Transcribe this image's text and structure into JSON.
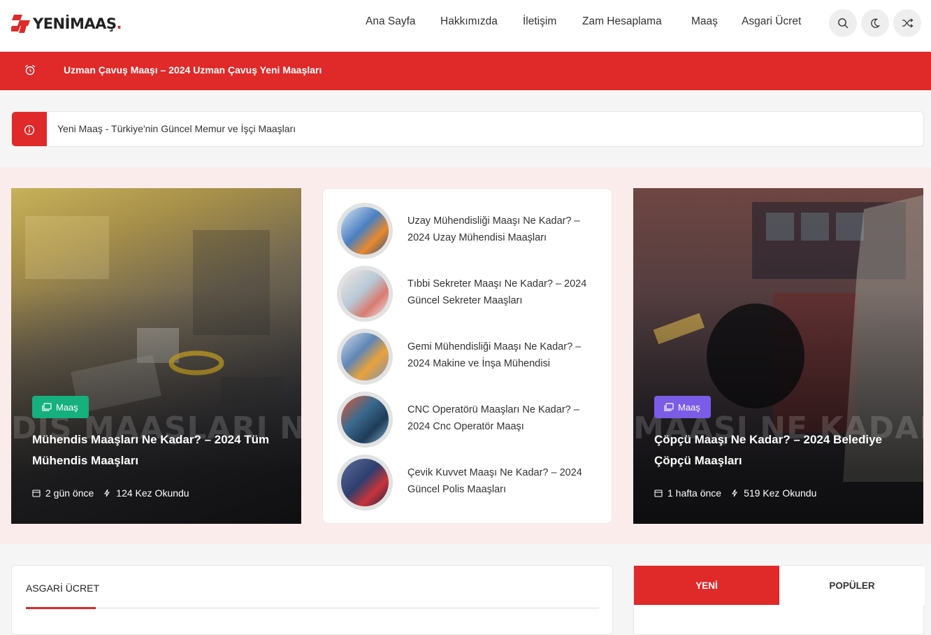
{
  "colors": {
    "accent": "#e02929",
    "badge_green": "#15b07d",
    "badge_purple": "#7b5ce6"
  },
  "logo": {
    "text": "YENİMAAŞ",
    "dot": "."
  },
  "nav": [
    {
      "label": "Ana Sayfa"
    },
    {
      "label": "Hakkımızda"
    },
    {
      "label": "İletişim"
    },
    {
      "label": "Zam Hesaplama"
    },
    {
      "label": "Maaş"
    },
    {
      "label": "Asgari Ücret"
    }
  ],
  "header_icons": [
    "search-icon",
    "moon-icon",
    "shuffle-icon"
  ],
  "breaking": {
    "icon": "alarm-icon",
    "text": "Uzman Çavuş Maaşı – 2024 Uzman Çavuş Yeni Maaşları"
  },
  "ticker": {
    "icon": "info-icon",
    "text": "Yeni Maaş - Türkiye'nin Güncel Memur ve İşçi Maaşları"
  },
  "featured_left": {
    "badge": "Maaş",
    "title": "Mühendis Maaşları Ne Kadar? – 2024 Tüm Mühendis Maaşları",
    "watermark": "DIS MAAŞLARI NE",
    "date": "2 gün önce",
    "views": "124 Kez Okundu"
  },
  "featured_right": {
    "badge": "Maaş",
    "title": "Çöpçü Maaşı Ne Kadar? – 2024 Belediye Çöpçü Maaşları",
    "watermark": "MAAŞI NE KADAR",
    "date": "1 hafta önce",
    "views": "519 Kez Okundu"
  },
  "list_items": [
    {
      "title": "Uzay Mühendisliği Maaşı Ne Kadar? – 2024 Uzay Mühendisi Maaşları",
      "thumb_color": "#4a7fc1"
    },
    {
      "title": "Tıbbi Sekreter Maaşı Ne Kadar? – 2024 Güncel Sekreter Maaşları",
      "thumb_color": "#b7c9d6"
    },
    {
      "title": "Gemi Mühendisliği Maaşı Ne Kadar? – 2024 Makine ve İnşa Mühendisi",
      "thumb_color": "#5f86b5"
    },
    {
      "title": "CNC Operatörü Maaşları Ne Kadar? – 2024 Cnc Operatör Maaşı",
      "thumb_color": "#3b6a8f"
    },
    {
      "title": "Çevik Kuvvet Maaşı Ne Kadar? – 2024 Güncel Polis Maaşları",
      "thumb_color": "#2e3e6e"
    }
  ],
  "asgari": {
    "title": "ASGARİ ÜCRET"
  },
  "tabs": {
    "new": "YENİ",
    "popular": "POPÜLER"
  }
}
